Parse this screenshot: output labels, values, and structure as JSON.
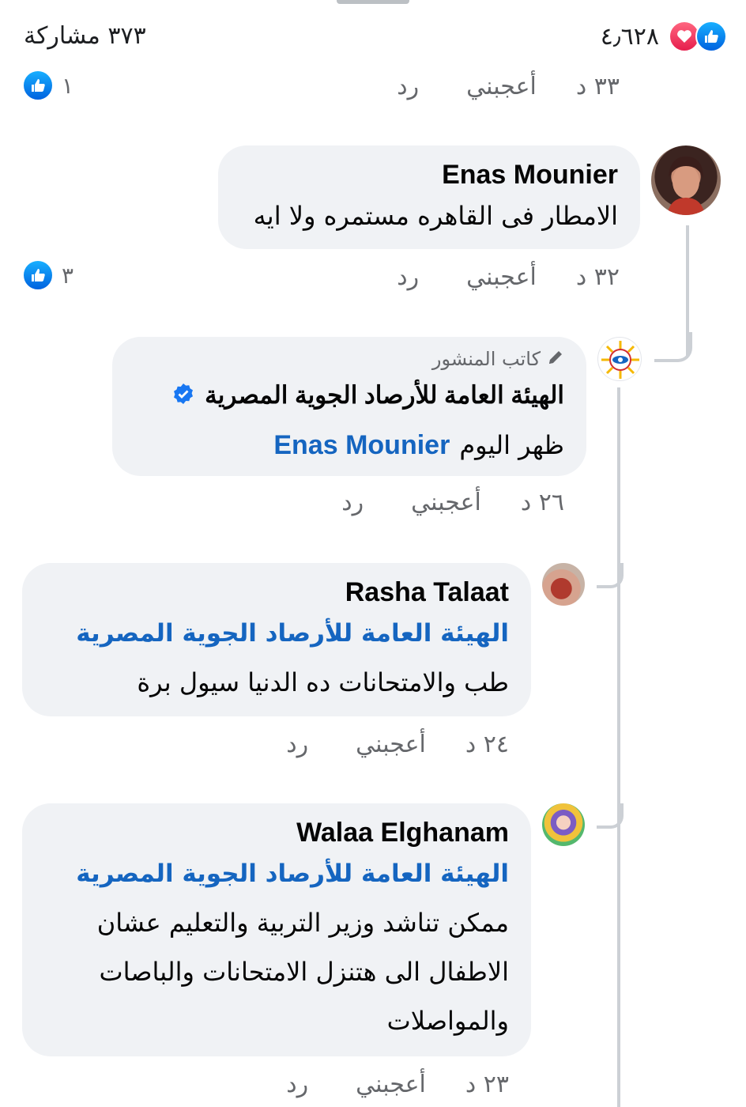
{
  "header": {
    "shares_text": "٣٧٣ مشاركة",
    "reactions_count": "٤٫٦٢٨"
  },
  "comments": [
    {
      "time": "٣٣ د",
      "like_label": "أعجبني",
      "reply_label": "رد",
      "likes": "١"
    },
    {
      "author": "Enas Mounier",
      "text": "الامطار فى القاهره مستمره ولا ايه",
      "time": "٣٢ د",
      "like_label": "أعجبني",
      "reply_label": "رد",
      "likes": "٣"
    },
    {
      "author_badge": "كاتب المنشور",
      "author": "الهيئة العامة للأرصاد الجوية المصرية",
      "text": "ظهر اليوم",
      "mention": "Enas Mounier",
      "time": "٢٦ د",
      "like_label": "أعجبني",
      "reply_label": "رد"
    },
    {
      "author": "Rasha Talaat",
      "mention": "الهيئة العامة للأرصاد الجوية المصرية",
      "text": "طب والامتحانات ده الدنيا سيول برة",
      "time": "٢٤ د",
      "like_label": "أعجبني",
      "reply_label": "رد"
    },
    {
      "author": "Walaa Elghanam",
      "mention": "الهيئة العامة للأرصاد الجوية المصرية",
      "text_lines": [
        "ممكن تناشد وزير التربية والتعليم عشان",
        "الاطفال الى هتنزل الامتحانات والباصات",
        "والمواصلات"
      ],
      "time": "٢٣ د",
      "like_label": "أعجبني",
      "reply_label": "رد"
    }
  ],
  "colors": {
    "like_blue": "#1877f2",
    "heart_red": "#f33e58",
    "mention_blue": "#1565c0",
    "bubble_bg": "#f0f2f5",
    "meta_gray": "#65676b"
  },
  "icons": [
    "like-icon",
    "heart-icon",
    "pencil-icon",
    "verified-badge-icon"
  ]
}
